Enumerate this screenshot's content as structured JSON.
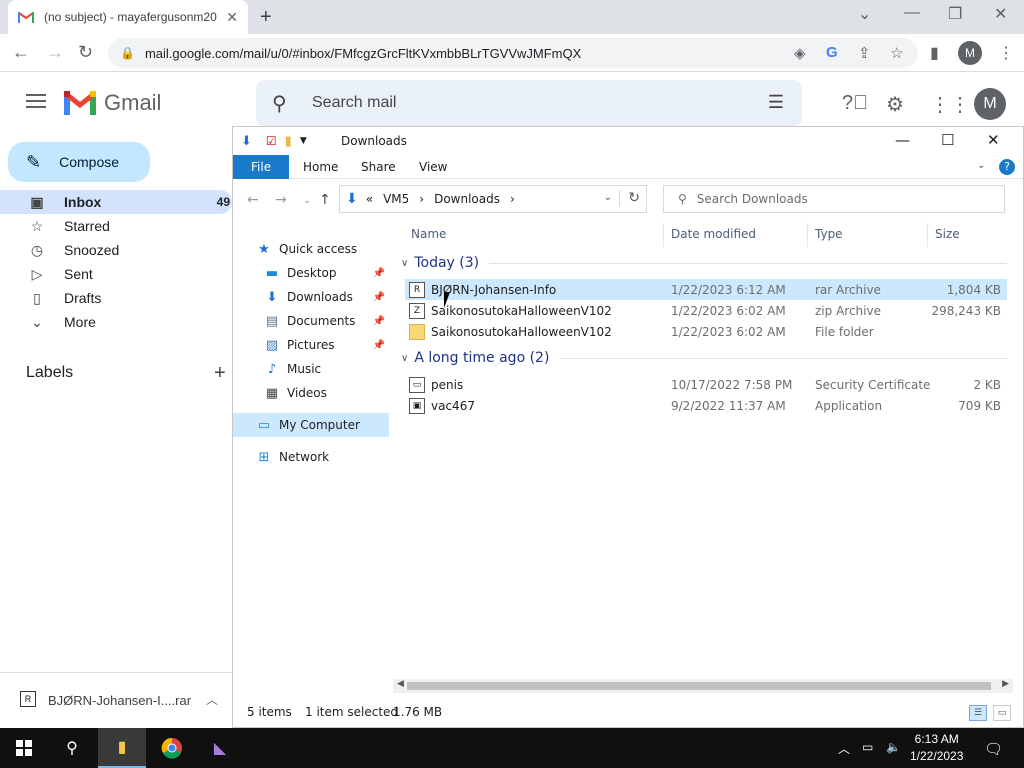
{
  "browser": {
    "tab_title": "(no subject) - mayafergusonm20",
    "tab_close": "✕",
    "new_tab": "+",
    "url": "mail.google.com/mail/u/0/#inbox/FMfcgzGrcFltKVxmbbBLrTGVVwJMFmQX",
    "profile_initial": "M"
  },
  "gmail": {
    "logo_text": "Gmail",
    "search_placeholder": "Search mail",
    "avatar_initial": "M",
    "compose_label": "Compose",
    "nav": [
      {
        "label": "Inbox",
        "count": "49",
        "icon": "inbox-icon",
        "glyph": "▣"
      },
      {
        "label": "Starred",
        "count": "",
        "icon": "star-icon",
        "glyph": "☆"
      },
      {
        "label": "Snoozed",
        "count": "",
        "icon": "clock-icon",
        "glyph": "◷"
      },
      {
        "label": "Sent",
        "count": "",
        "icon": "send-icon",
        "glyph": "▷"
      },
      {
        "label": "Drafts",
        "count": "",
        "icon": "draft-icon",
        "glyph": "▯"
      },
      {
        "label": "More",
        "count": "",
        "icon": "chevron-down-icon",
        "glyph": "⌄"
      }
    ],
    "labels_heading": "Labels",
    "download_shelf": {
      "filename": "BJØRN-Johansen-I....rar"
    }
  },
  "explorer": {
    "title": "Downloads",
    "ribbon_tabs": [
      "File",
      "Home",
      "Share",
      "View"
    ],
    "address": {
      "overflow": "«",
      "parts": [
        "VM5",
        "Downloads"
      ]
    },
    "search_placeholder": "Search Downloads",
    "nav_pane": [
      {
        "label": "Quick access",
        "glyph": "★",
        "color": "#1c6fd4",
        "indent": 0,
        "pinned": false
      },
      {
        "label": "Desktop",
        "glyph": "▬",
        "color": "#1c8ad8",
        "indent": 1,
        "pinned": true
      },
      {
        "label": "Downloads",
        "glyph": "⬇",
        "color": "#1c6fd4",
        "indent": 1,
        "pinned": true
      },
      {
        "label": "Documents",
        "glyph": "▤",
        "color": "#5a6f8c",
        "indent": 1,
        "pinned": true
      },
      {
        "label": "Pictures",
        "glyph": "▨",
        "color": "#3a7ab8",
        "indent": 1,
        "pinned": true
      },
      {
        "label": "Music",
        "glyph": "♪",
        "color": "#1c6fd4",
        "indent": 1,
        "pinned": false
      },
      {
        "label": "Videos",
        "glyph": "▦",
        "color": "#444",
        "indent": 1,
        "pinned": false
      },
      {
        "label": "My Computer",
        "glyph": "▭",
        "color": "#1c8ad8",
        "indent": 0,
        "pinned": false,
        "selected": true
      },
      {
        "label": "Network",
        "glyph": "⊞",
        "color": "#1c8ad8",
        "indent": 0,
        "pinned": false
      }
    ],
    "columns": {
      "name": "Name",
      "date": "Date modified",
      "type": "Type",
      "size": "Size"
    },
    "groups": [
      {
        "title": "Today (3)",
        "files": [
          {
            "name": "BJØRN-Johansen-Info",
            "date": "1/22/2023 6:12 AM",
            "type": "rar Archive",
            "size": "1,804 KB",
            "icon": "rar-archive-icon",
            "badge": "R",
            "selected": true
          },
          {
            "name": "SaikonosutokaHalloweenV102",
            "date": "1/22/2023 6:02 AM",
            "type": "zip Archive",
            "size": "298,243 KB",
            "icon": "zip-archive-icon",
            "badge": "Z",
            "selected": false
          },
          {
            "name": "SaikonosutokaHalloweenV102",
            "date": "1/22/2023 6:02 AM",
            "type": "File folder",
            "size": "",
            "icon": "folder-icon",
            "badge": "",
            "selected": false
          }
        ]
      },
      {
        "title": "A long time ago (2)",
        "files": [
          {
            "name": "penis",
            "date": "10/17/2022 7:58 PM",
            "type": "Security Certificate",
            "size": "2 KB",
            "icon": "certificate-icon",
            "badge": "▭",
            "selected": false
          },
          {
            "name": "vac467",
            "date": "9/2/2022 11:37 AM",
            "type": "Application",
            "size": "709 KB",
            "icon": "application-icon",
            "badge": "▣",
            "selected": false
          }
        ]
      }
    ],
    "status": {
      "items": "5 items",
      "selected": "1 item selected",
      "size": "1.76 MB"
    }
  },
  "taskbar": {
    "time": "6:13 AM",
    "date": "1/22/2023"
  }
}
